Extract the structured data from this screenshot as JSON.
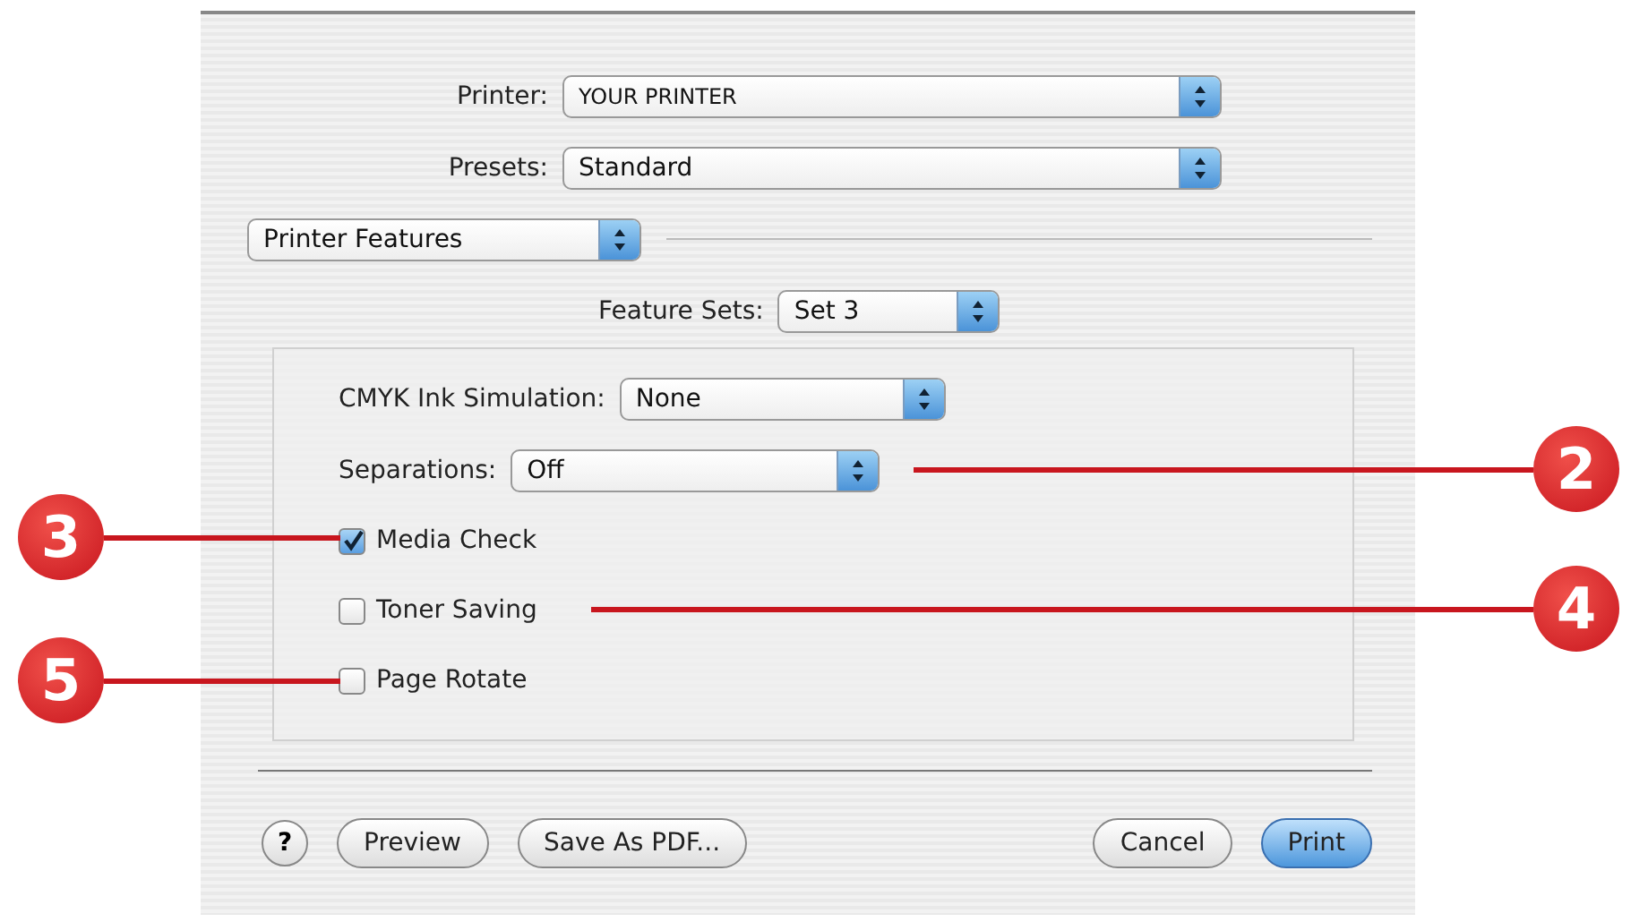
{
  "printer": {
    "label": "Printer:",
    "value": "YOUR PRINTER"
  },
  "presets": {
    "label": "Presets:",
    "value": "Standard"
  },
  "panel_menu": {
    "value": "Printer Features"
  },
  "feature_sets": {
    "label": "Feature Sets:",
    "value": "Set 3"
  },
  "popups": [
    {
      "label": "CMYK Ink Simulation:",
      "value": "None"
    },
    {
      "label": "Separations:",
      "value": "Off"
    }
  ],
  "checkboxes": [
    {
      "label": "Media Check",
      "checked": true
    },
    {
      "label": "Toner Saving",
      "checked": false
    },
    {
      "label": "Page Rotate",
      "checked": false
    }
  ],
  "buttons": [
    {
      "label": "Preview",
      "kind": "plain"
    },
    {
      "label": "Save As PDF...",
      "kind": "plain"
    },
    {
      "label": "Cancel",
      "kind": "plain"
    },
    {
      "label": "Print",
      "kind": "default"
    }
  ],
  "help": {
    "label": "?"
  },
  "callouts": [
    {
      "number": "2",
      "kind": "right"
    },
    {
      "number": "3",
      "kind": "left"
    },
    {
      "number": "4",
      "kind": "right"
    },
    {
      "number": "5",
      "kind": "left"
    }
  ]
}
